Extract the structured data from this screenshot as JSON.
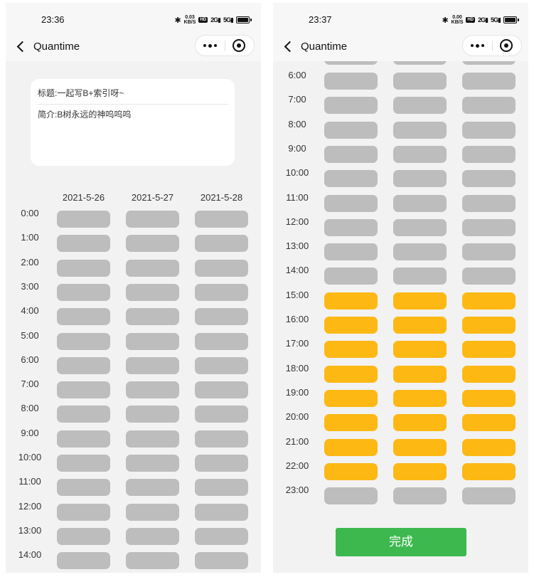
{
  "app": {
    "title": "Quantime"
  },
  "colors": {
    "slot_default": "#bdbdbd",
    "slot_selected": "#fdb814",
    "done_button": "#3cb84f"
  },
  "left": {
    "status": {
      "time": "23:36",
      "speed_top": "0.03",
      "speed_unit": "KB/S",
      "hd": "HD",
      "signal1": "2G",
      "signal2": "5G"
    },
    "card": {
      "title": "标题:一起写B+索引呀~",
      "desc": "简介:B树永远的神呜呜呜"
    },
    "dates": [
      "2021-5-26",
      "2021-5-27",
      "2021-5-28"
    ],
    "hours": [
      "0:00",
      "1:00",
      "2:00",
      "3:00",
      "4:00",
      "5:00",
      "6:00",
      "7:00",
      "8:00",
      "9:00",
      "10:00",
      "11:00",
      "12:00",
      "13:00",
      "14:00"
    ]
  },
  "right": {
    "status": {
      "time": "23:37",
      "speed_top": "0.00",
      "speed_unit": "KB/S",
      "hd": "HD",
      "signal1": "2G",
      "signal2": "5G"
    },
    "hours": [
      "6:00",
      "7:00",
      "8:00",
      "9:00",
      "10:00",
      "11:00",
      "12:00",
      "13:00",
      "14:00",
      "15:00",
      "16:00",
      "17:00",
      "18:00",
      "19:00",
      "20:00",
      "21:00",
      "22:00",
      "23:00"
    ],
    "selected_hours": [
      "15:00",
      "16:00",
      "17:00",
      "18:00",
      "19:00",
      "20:00",
      "21:00",
      "22:00"
    ],
    "done_label": "完成"
  },
  "icons": {
    "back": "chevron-left-icon",
    "more": "more-dots-icon",
    "close": "target-close-icon",
    "bluetooth": "bluetooth-icon",
    "battery": "battery-icon"
  }
}
